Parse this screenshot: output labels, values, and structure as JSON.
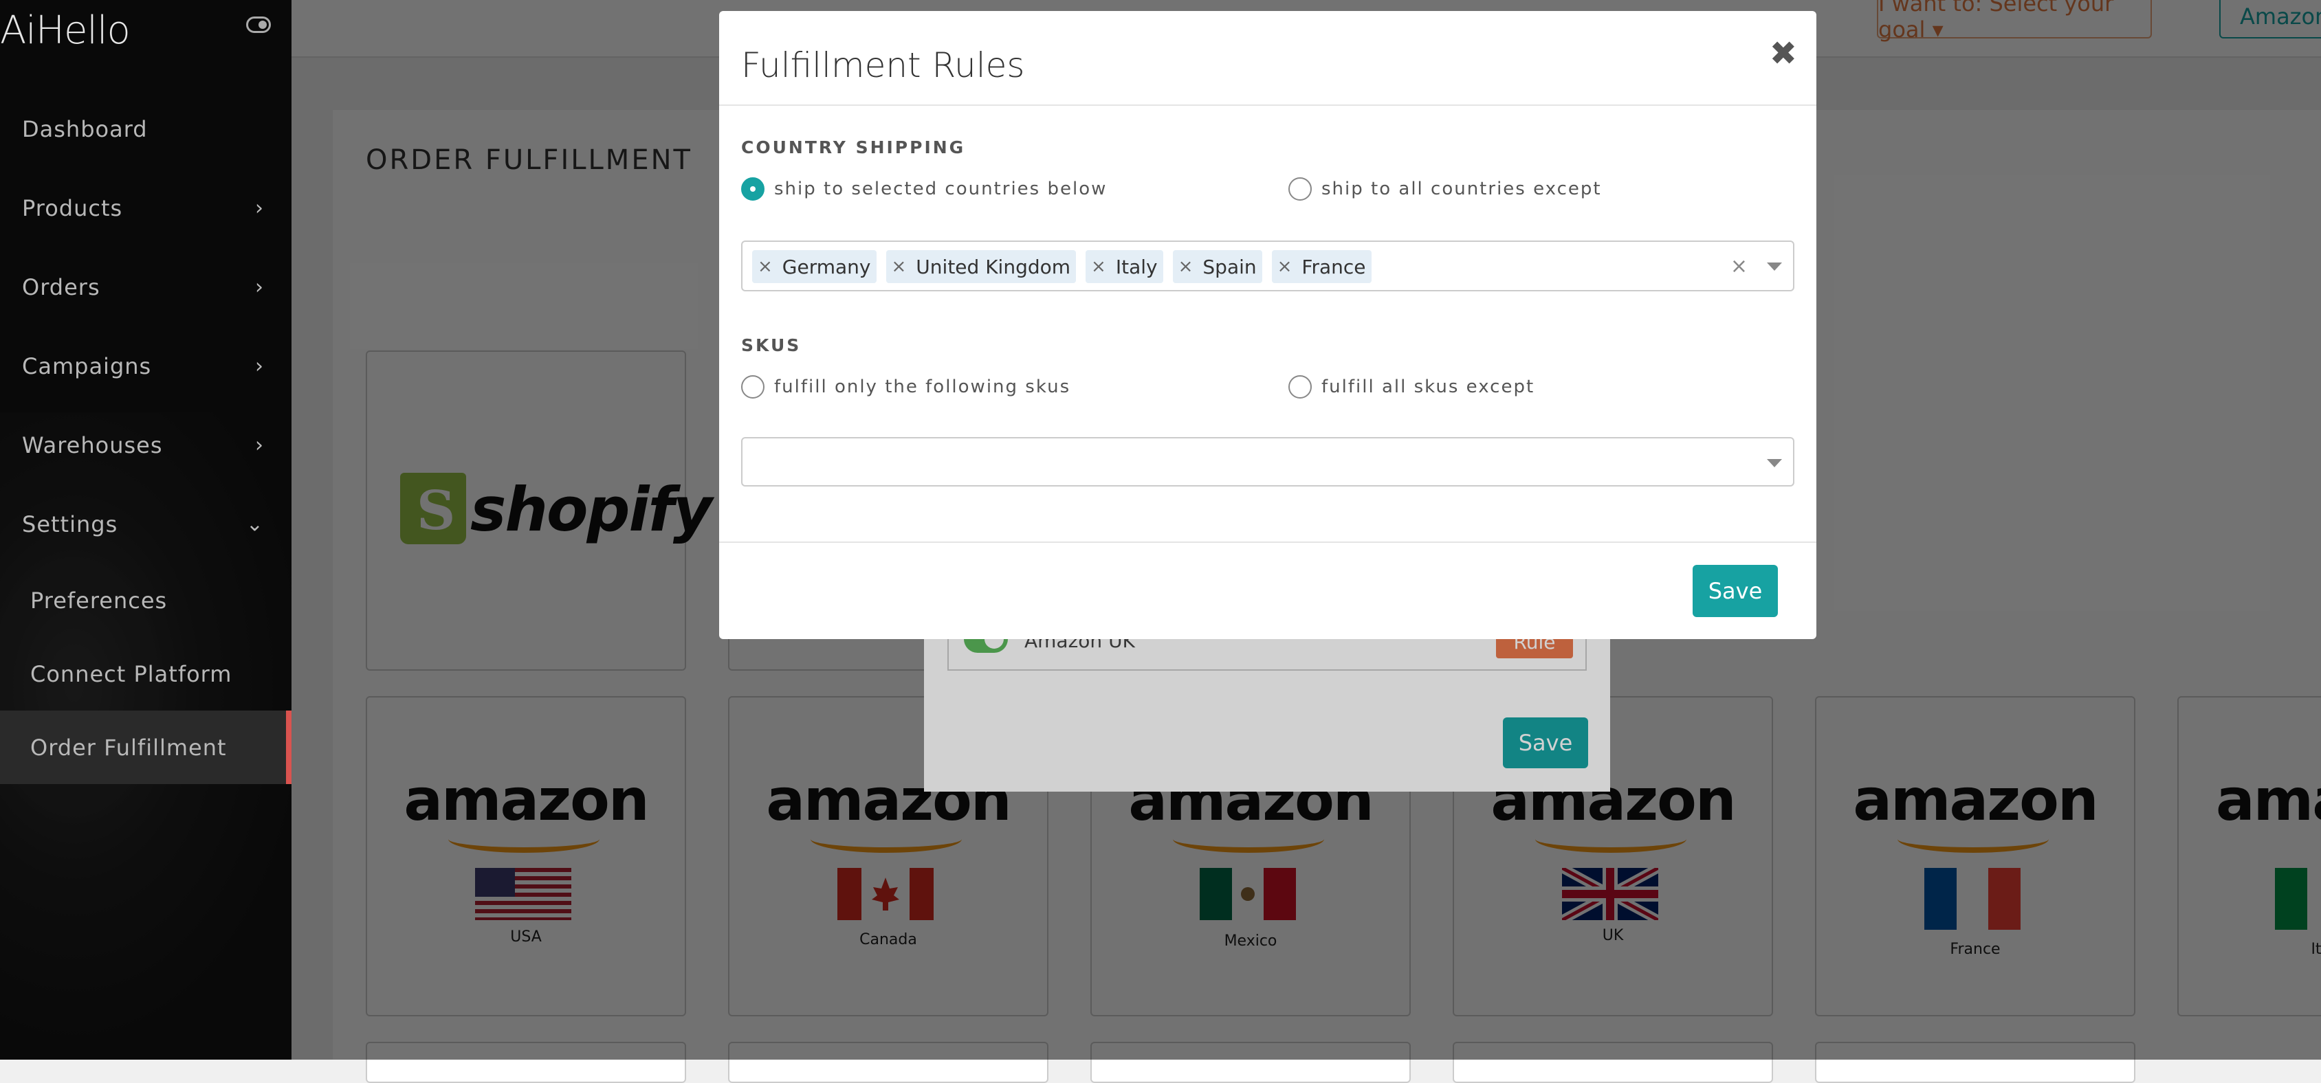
{
  "app": {
    "logo_text": "AiHello"
  },
  "topbar": {
    "goal_label": "I want to: Select your goal ▾",
    "amazon_label": "Amazon"
  },
  "sidebar": {
    "items": [
      {
        "label": "Dashboard",
        "has_chevron": false
      },
      {
        "label": "Products",
        "chevron": "›"
      },
      {
        "label": "Orders",
        "chevron": "›"
      },
      {
        "label": "Campaigns",
        "chevron": "›"
      },
      {
        "label": "Warehouses",
        "chevron": "›"
      },
      {
        "label": "Settings",
        "chevron": "⌄"
      }
    ],
    "sub_items": [
      {
        "label": "Preferences"
      },
      {
        "label": "Connect Platform"
      },
      {
        "label": "Order Fulfillment",
        "active": true
      }
    ]
  },
  "page": {
    "title": "ORDER FULFILLMENT"
  },
  "platforms": {
    "shopify": {
      "text": "shopify"
    },
    "amazon": [
      {
        "text": "amazon",
        "country": "USA"
      },
      {
        "text": "amazon",
        "country": "Canada"
      },
      {
        "text": "amazon",
        "country": "Mexico"
      },
      {
        "text": "amazon",
        "country": "UK"
      },
      {
        "text": "amazon",
        "country": "France"
      },
      {
        "text": "ama",
        "country": "It"
      }
    ]
  },
  "background_modal": {
    "toggle_label": "Amazon UK",
    "rule_label": "Rule",
    "save_label": "Save"
  },
  "modal": {
    "title": "Fulfillment Rules",
    "close_glyph": "✖",
    "country_section": {
      "label": "COUNTRY SHIPPING",
      "option_selected": "ship to selected countries below",
      "option_other": "ship to all countries except",
      "countries": [
        "Germany",
        "United Kingdom",
        "Italy",
        "Spain",
        "France"
      ],
      "tag_remove_glyph": "×",
      "clear_glyph": "×"
    },
    "skus_section": {
      "label": "SKUS",
      "option_only": "fulfill only the following skus",
      "option_except": "fulfill all skus except"
    },
    "save_label": "Save"
  },
  "colors": {
    "accent": "#17a2a2",
    "warning": "#e8774b",
    "active_marker": "#d9534f"
  }
}
